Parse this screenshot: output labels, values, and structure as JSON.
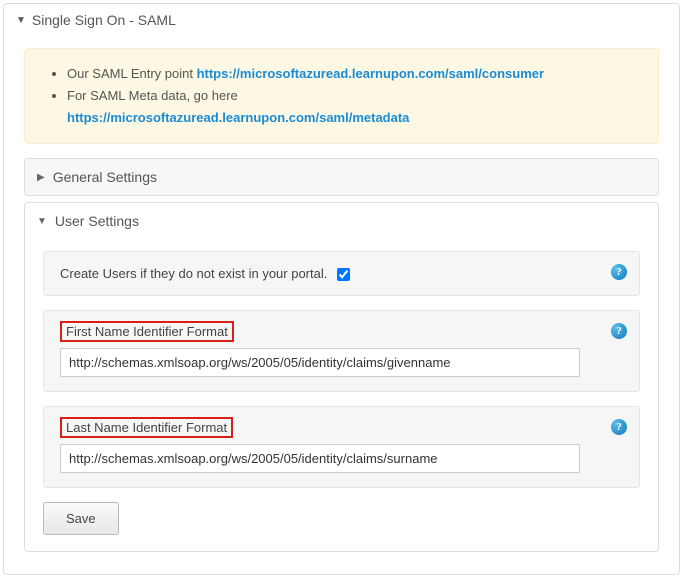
{
  "page_title": "Single Sign On - SAML",
  "info": {
    "line1_prefix": "Our SAML Entry point ",
    "line1_link": "https://microsoftazuread.learnupon.com/saml/consumer",
    "line2_prefix": "For SAML Meta data, go here ",
    "line2_link": "https://microsoftazuread.learnupon.com/saml/metadata"
  },
  "sections": {
    "general": {
      "title": "General Settings"
    },
    "user": {
      "title": "User Settings"
    }
  },
  "user_settings": {
    "create_users_label": "Create Users if they do not exist in your portal.",
    "create_users_checked": true,
    "first_name": {
      "label": "First Name Identifier Format",
      "value": "http://schemas.xmlsoap.org/ws/2005/05/identity/claims/givenname"
    },
    "last_name": {
      "label": "Last Name Identifier Format",
      "value": "http://schemas.xmlsoap.org/ws/2005/05/identity/claims/surname"
    }
  },
  "buttons": {
    "save": "Save"
  },
  "icons": {
    "help": "?"
  }
}
